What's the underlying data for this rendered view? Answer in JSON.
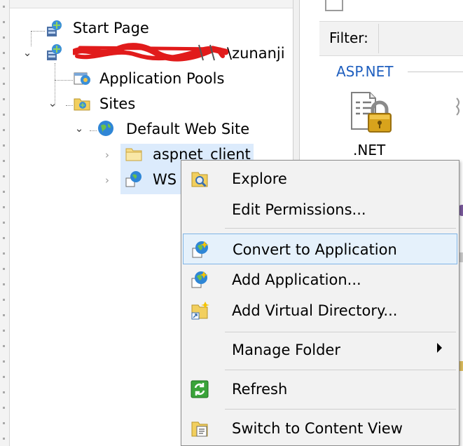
{
  "tree": {
    "start_page": "Start Page",
    "server": "\\zunanji",
    "app_pools": "Application Pools",
    "sites": "Sites",
    "default_site": "Default Web Site",
    "aspnet_client": "aspnet_client",
    "ws": "WS"
  },
  "features": {
    "filter_label": "Filter:",
    "group": "ASP.NET",
    "net_label": ".NET"
  },
  "menu": {
    "items": [
      {
        "label": "Explore",
        "icon": "explore-folder-icon"
      },
      {
        "label": "Edit Permissions...",
        "icon": ""
      },
      {
        "label": "Convert to Application",
        "icon": "convert-application-icon"
      },
      {
        "label": "Add Application...",
        "icon": "add-application-icon"
      },
      {
        "label": "Add Virtual Directory...",
        "icon": "add-virtual-directory-icon"
      },
      {
        "label": "Manage Folder",
        "icon": ""
      },
      {
        "label": "Refresh",
        "icon": "refresh-icon"
      },
      {
        "label": "Switch to Content View",
        "icon": "content-view-icon"
      }
    ]
  },
  "colors": {
    "menu_bg": "#f2f2f2",
    "highlight_bg": "#e5f1fb",
    "highlight_border": "#7fb4e6",
    "group_label": "#1f5fbf",
    "tree_selection": "#dcebfc"
  }
}
